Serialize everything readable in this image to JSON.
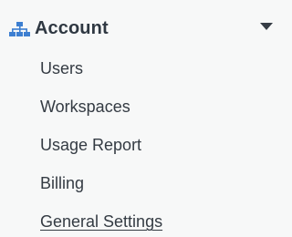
{
  "section": {
    "icon": "sitemap-icon",
    "title": "Account",
    "toggle_icon": "caret-down-icon",
    "expanded": true
  },
  "nav": {
    "items": [
      {
        "label": "Users",
        "active": false
      },
      {
        "label": "Workspaces",
        "active": false
      },
      {
        "label": "Usage Report",
        "active": false
      },
      {
        "label": "Billing",
        "active": false
      },
      {
        "label": "General Settings",
        "active": true
      }
    ]
  },
  "colors": {
    "background": "#f7f8f8",
    "icon_accent": "#3d7fd1",
    "text": "#343b43",
    "title_text": "#2f3842"
  }
}
